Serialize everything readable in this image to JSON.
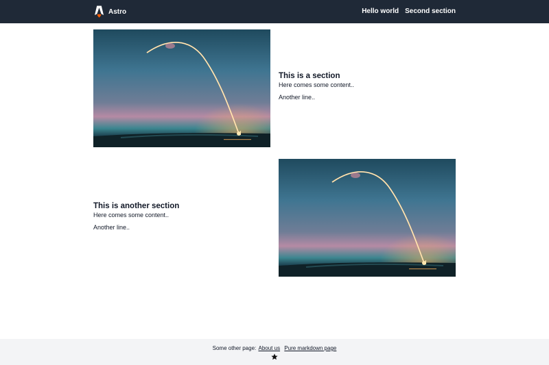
{
  "navbar": {
    "brand": "Astro",
    "links": [
      "Hello world",
      "Second section"
    ]
  },
  "sections": [
    {
      "title": "This is a section",
      "lines": [
        "Here comes some content..",
        "Another line.."
      ],
      "image_alt": "rocket-launch-image"
    },
    {
      "title": "This is another section",
      "lines": [
        "Here comes some content..",
        "Another line.."
      ],
      "image_alt": "rocket-launch-image"
    }
  ],
  "footer": {
    "prefix": "Some other page:",
    "links": [
      "About us",
      "Pure markdown page"
    ],
    "icon": "star-icon"
  },
  "colors": {
    "navbar_bg": "#1f2937",
    "footer_bg": "#f3f4f6",
    "text": "#111827"
  }
}
